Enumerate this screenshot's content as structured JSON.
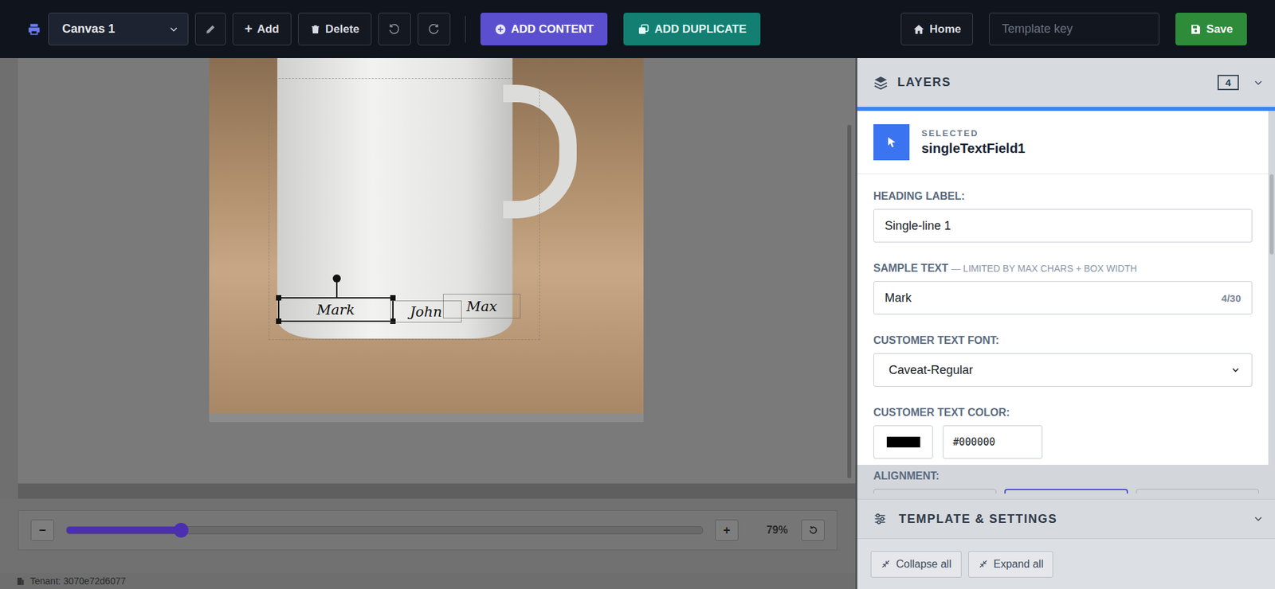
{
  "toolbar": {
    "canvas_select": "Canvas 1",
    "add": {
      "icon": "+",
      "label": "Add"
    },
    "delete": "Delete",
    "add_content": "ADD CONTENT",
    "add_duplicate": "ADD DUPLICATE",
    "home": "Home",
    "template_key_placeholder": "Template key",
    "save": "Save"
  },
  "canvas": {
    "layers": [
      {
        "text": "Mark",
        "selected": true
      },
      {
        "text": "John",
        "selected": false
      },
      {
        "text": "Max",
        "selected": false
      }
    ]
  },
  "zoom": {
    "minus": "−",
    "plus": "+",
    "level": 0.18,
    "reading": "79%"
  },
  "footer": {
    "tenant": "Tenant: 3070e72d6077"
  },
  "layers_panel": {
    "title": "LAYERS",
    "count": "4",
    "expanded": true
  },
  "selected_layer": {
    "caption": "SELECTED",
    "name": "singleTextField1"
  },
  "fields": {
    "heading_label": {
      "label": "HEADING LABEL:",
      "value": "Single-line 1"
    },
    "sample_text": {
      "label": "SAMPLE TEXT",
      "hint": "— LIMITED BY MAX CHARS + BOX WIDTH",
      "value": "Mark",
      "counter": "4/30"
    },
    "font": {
      "label": "CUSTOMER TEXT FONT:",
      "value": "Caveat-Regular"
    },
    "color": {
      "label": "CUSTOMER TEXT COLOR:",
      "value": "#000000"
    },
    "alignment": {
      "label": "ALIGNMENT:",
      "options": [
        {
          "selected": false
        },
        {
          "selected": true
        },
        {
          "selected": false
        }
      ]
    }
  },
  "sections": [
    {
      "title": "TEMPLATE & SETTINGS",
      "expanded": false
    }
  ],
  "actions": [
    "Collapse all",
    "Expand all"
  ]
}
